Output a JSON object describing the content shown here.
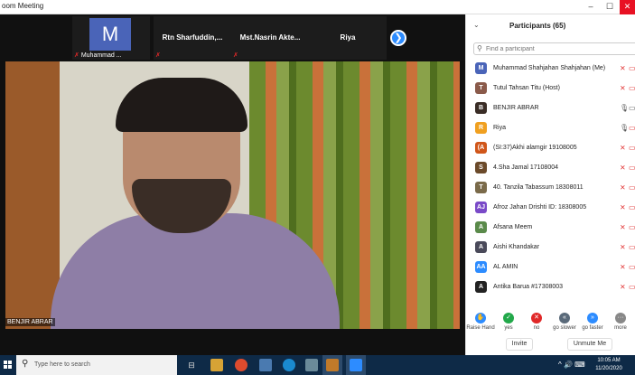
{
  "window": {
    "title": "oom Meeting",
    "minimize": "–",
    "maximize": "☐",
    "close": "✕"
  },
  "thumbnails": [
    {
      "name": "",
      "avatar_letter": "M",
      "sub_label": "Muhammad ..."
    },
    {
      "name": "Rtn Sharfuddin,...",
      "sub_label": ""
    },
    {
      "name": "Mst.Nasrin Akte...",
      "sub_label": ""
    },
    {
      "name": "Riya",
      "sub_label": ""
    }
  ],
  "next_button": "❯",
  "active_speaker_label": "BENJIR ABRAR",
  "participants_panel": {
    "chevron": "⌄",
    "title": "Participants (65)",
    "search_placeholder": "Find a participant",
    "participants": [
      {
        "name": "Muhammad Shahjahan Shahjahan (Me)",
        "initial": "M",
        "color": "#4a64b8",
        "mic_muted": true,
        "video_off": true
      },
      {
        "name": "Tutul Tahsan Titu (Host)",
        "initial": "T",
        "color": "#8a5a4a",
        "mic_muted": true,
        "video_off": true
      },
      {
        "name": "BENJIR ABRAR",
        "initial": "B",
        "color": "#3a2d26",
        "mic_muted": false,
        "video_off": false
      },
      {
        "name": "Riya",
        "initial": "R",
        "color": "#f0a020",
        "mic_muted": false,
        "video_off": true
      },
      {
        "name": "(SI:37)Akhi alamgir 19108005",
        "initial": "(A",
        "color": "#d0561a",
        "mic_muted": true,
        "video_off": true
      },
      {
        "name": "4.Sha Jamal 17108004",
        "initial": "S",
        "color": "#6b4a2a",
        "mic_muted": true,
        "video_off": true
      },
      {
        "name": "40. Tanzila Tabassum 18308011",
        "initial": "T",
        "color": "#7a6a4a",
        "mic_muted": true,
        "video_off": true
      },
      {
        "name": "Afroz Jahan Drishti ID: 18308005",
        "initial": "AJ",
        "color": "#7a4ac8",
        "mic_muted": true,
        "video_off": true
      },
      {
        "name": "Afsana Meem",
        "initial": "A",
        "color": "#5a8a4a",
        "mic_muted": true,
        "video_off": true
      },
      {
        "name": "Aishi Khandakar",
        "initial": "A",
        "color": "#4a4a5a",
        "mic_muted": true,
        "video_off": true
      },
      {
        "name": "AL AMIN",
        "initial": "AA",
        "color": "#2d8cff",
        "mic_muted": true,
        "video_off": true
      },
      {
        "name": "Antika Barua #17308003",
        "initial": "A",
        "color": "#222222",
        "mic_muted": true,
        "video_off": true
      }
    ],
    "reactions": [
      {
        "label": "Raise Hand",
        "glyph": "✋",
        "color": "#2d8cff"
      },
      {
        "label": "yes",
        "glyph": "✓",
        "color": "#22a84a"
      },
      {
        "label": "no",
        "glyph": "✕",
        "color": "#e02828"
      },
      {
        "label": "go slower",
        "glyph": "«",
        "color": "#5a6a7a"
      },
      {
        "label": "go faster",
        "glyph": "»",
        "color": "#2d8cff"
      },
      {
        "label": "more",
        "glyph": "···",
        "color": "#888888"
      }
    ],
    "invite_button": "Invite",
    "unmute_me_button": "Unmute Me"
  },
  "taskbar": {
    "search_placeholder": "Type here to search",
    "tray_text": "^ 🔊 ⌨",
    "time": "10:05 AM",
    "date": "11/20/2020"
  }
}
